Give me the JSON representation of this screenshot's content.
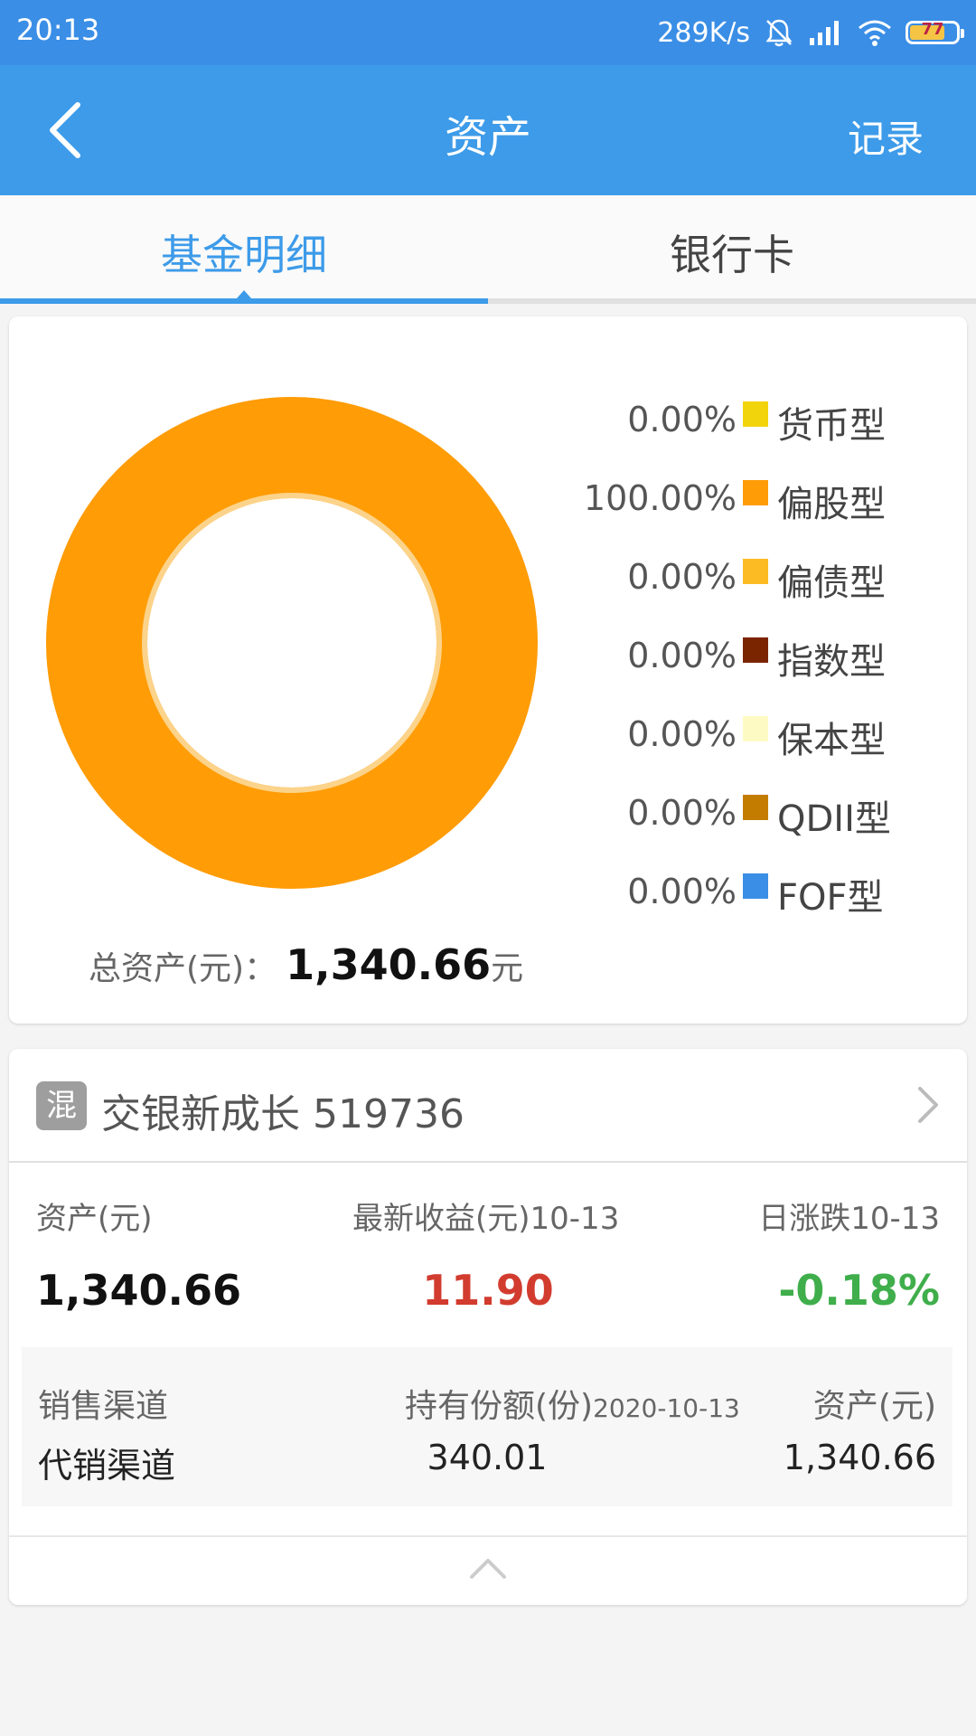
{
  "status_bar": {
    "time": "20:13",
    "network_speed": "289K/s",
    "battery_level": "77",
    "icons": [
      "bell-off-icon",
      "signal-icon",
      "wifi-icon",
      "battery-icon"
    ]
  },
  "nav": {
    "title": "资产",
    "record_label": "记录",
    "back_icon": "back-arrow-icon"
  },
  "tabs": [
    {
      "label": "基金明细",
      "active": true
    },
    {
      "label": "银行卡",
      "active": false
    }
  ],
  "colors": {
    "accent": "#3d9be9",
    "status_bar": "#3a8ee6",
    "positive": "#d23c2f",
    "negative": "#3fae4b"
  },
  "chart_data": {
    "type": "pie",
    "donut": true,
    "legend_position": "right",
    "slices": [
      {
        "label": "货币型",
        "value": 0.0,
        "display": "0.00%",
        "color": "#f2d40d"
      },
      {
        "label": "偏股型",
        "value": 100.0,
        "display": "100.00%",
        "color": "#ff9c06"
      },
      {
        "label": "偏债型",
        "value": 0.0,
        "display": "0.00%",
        "color": "#fdbb23"
      },
      {
        "label": "指数型",
        "value": 0.0,
        "display": "0.00%",
        "color": "#7b2400"
      },
      {
        "label": "保本型",
        "value": 0.0,
        "display": "0.00%",
        "color": "#fdfbc3"
      },
      {
        "label": "QDII型",
        "value": 0.0,
        "display": "0.00%",
        "color": "#c37c00"
      },
      {
        "label": "FOF型",
        "value": 0.0,
        "display": "0.00%",
        "color": "#3a8ee6"
      }
    ]
  },
  "total": {
    "label": "总资产(元)：",
    "value": "1,340.66",
    "unit": "元"
  },
  "fund": {
    "badge": "混",
    "name": "交银新成长 519736",
    "metrics": [
      {
        "label": "资产(元)",
        "value": "1,340.66"
      },
      {
        "label": "最新收益(元)10-13",
        "value": "11.90"
      },
      {
        "label": "日涨跌10-13",
        "value": "-0.18%"
      }
    ],
    "channel": {
      "col1_label": "销售渠道",
      "col2_label": "持有份额(份)",
      "col2_date": "2020-10-13",
      "col3_label": "资产(元)",
      "col1_value": "代销渠道",
      "col2_value": "340.01",
      "col3_value": "1,340.66"
    }
  }
}
